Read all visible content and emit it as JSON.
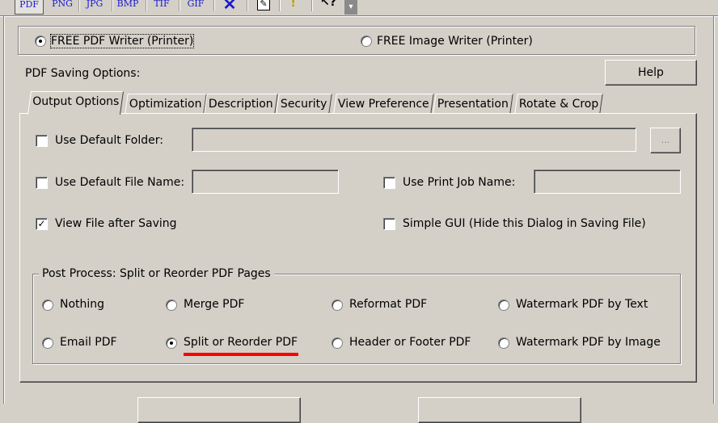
{
  "toolbar": {
    "formats": [
      "PDF",
      "PNG",
      "JPG",
      "BMP",
      "TIF",
      "GIF"
    ]
  },
  "printer": {
    "options": [
      {
        "label": "FREE PDF Writer (Printer)",
        "selected": true
      },
      {
        "label": "FREE Image Writer (Printer)",
        "selected": false
      }
    ]
  },
  "pdf_options_label": "PDF Saving Options:",
  "help_label": "Help",
  "tabs": [
    "Output Options",
    "Optimization",
    "Description",
    "Security",
    "View Preference",
    "Presentation",
    "Rotate & Crop"
  ],
  "output": {
    "use_default_folder": {
      "label": "Use Default Folder:",
      "checked": false,
      "value": ""
    },
    "browse_label": "...",
    "use_default_file_name": {
      "label": "Use Default File Name:",
      "checked": false,
      "value": ""
    },
    "use_print_job_name": {
      "label": "Use Print Job Name:",
      "checked": false,
      "value": ""
    },
    "view_file_after_saving": {
      "label": "View File after Saving",
      "checked": true
    },
    "simple_gui": {
      "label": "Simple GUI (Hide this Dialog in Saving File)",
      "checked": false
    }
  },
  "post_process": {
    "title": "Post Process: Split or Reorder PDF Pages",
    "options": [
      "Nothing",
      "Merge PDF",
      "Reformat PDF",
      "Watermark PDF by Text",
      "Email PDF",
      "Split or Reorder PDF",
      "Header or Footer PDF",
      "Watermark PDF by Image"
    ],
    "selected": "Split or Reorder PDF",
    "highlight_color": "#ff0000"
  }
}
